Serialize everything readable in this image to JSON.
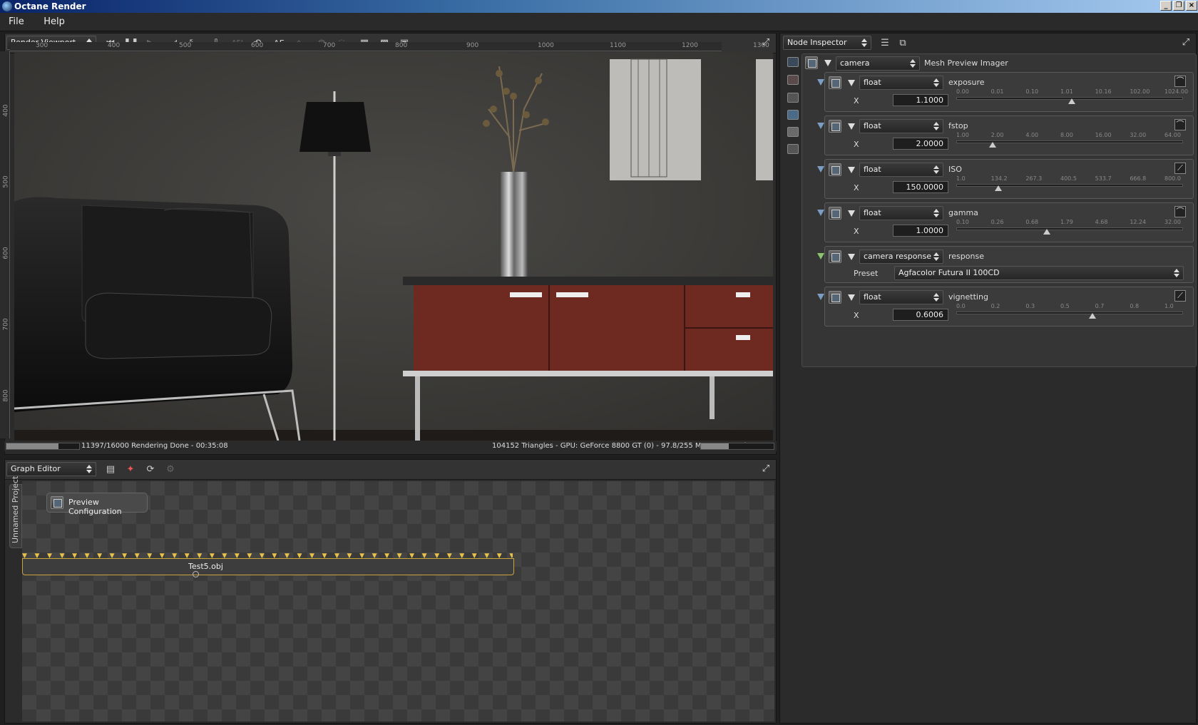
{
  "window": {
    "title": "Octane Render"
  },
  "menu": [
    "File",
    "Help"
  ],
  "viewport": {
    "mode": "Render Viewport",
    "ruler_x": [
      "300",
      "400",
      "500",
      "600",
      "700",
      "800",
      "900",
      "1000",
      "1100",
      "1200",
      "1300"
    ],
    "ruler_y": [
      "400",
      "500",
      "600",
      "700",
      "800"
    ],
    "status_left": "11397/16000 Rendering Done - 00:35:08",
    "status_right": "104152 Triangles - GPU: GeForce 8800 GT (0) - 97.8/255 MB Mem Used",
    "toolbar_af": "AF",
    "toolbar_afl": "AF!",
    "render_progress": 0.7123,
    "mem_progress": 0.38
  },
  "graph_editor": {
    "mode": "Graph Editor",
    "project_tab": "Unnamed Project",
    "node_preview": "Preview Configuration",
    "node_mesh": "Test5.obj"
  },
  "inspector": {
    "mode": "Node Inspector",
    "root": {
      "type": "camera",
      "name": "Mesh Preview Imager"
    },
    "params": [
      {
        "type": "float",
        "name": "exposure",
        "axis": "X",
        "value": "1.1000",
        "ticks": [
          "0.00",
          "0.01",
          "0.10",
          "1.01",
          "10.16",
          "102.00",
          "1024.00"
        ],
        "pos": 0.51
      },
      {
        "type": "float",
        "name": "fstop",
        "axis": "X",
        "value": "2.0000",
        "ticks": [
          "1.00",
          "2.00",
          "4.00",
          "8.00",
          "16.00",
          "32.00",
          "64.00"
        ],
        "pos": 0.16
      },
      {
        "type": "float",
        "name": "ISO",
        "axis": "X",
        "value": "150.0000",
        "ticks": [
          "1.0",
          "134.2",
          "267.3",
          "400.5",
          "533.7",
          "666.8",
          "800.0"
        ],
        "pos": 0.187
      },
      {
        "type": "float",
        "name": "gamma",
        "axis": "X",
        "value": "1.0000",
        "ticks": [
          "0.10",
          "0.26",
          "0.68",
          "1.79",
          "4.68",
          "12.24",
          "32.00"
        ],
        "pos": 0.4
      },
      {
        "type": "float",
        "name": "vignetting",
        "axis": "X",
        "value": "0.6006",
        "ticks": [
          "0.0",
          "0.2",
          "0.3",
          "0.5",
          "0.7",
          "0.8",
          "1.0"
        ],
        "pos": 0.6006
      }
    ],
    "response": {
      "type": "camera response",
      "name": "response",
      "preset_label": "Preset",
      "preset_value": "Agfacolor Futura II 100CD"
    }
  }
}
